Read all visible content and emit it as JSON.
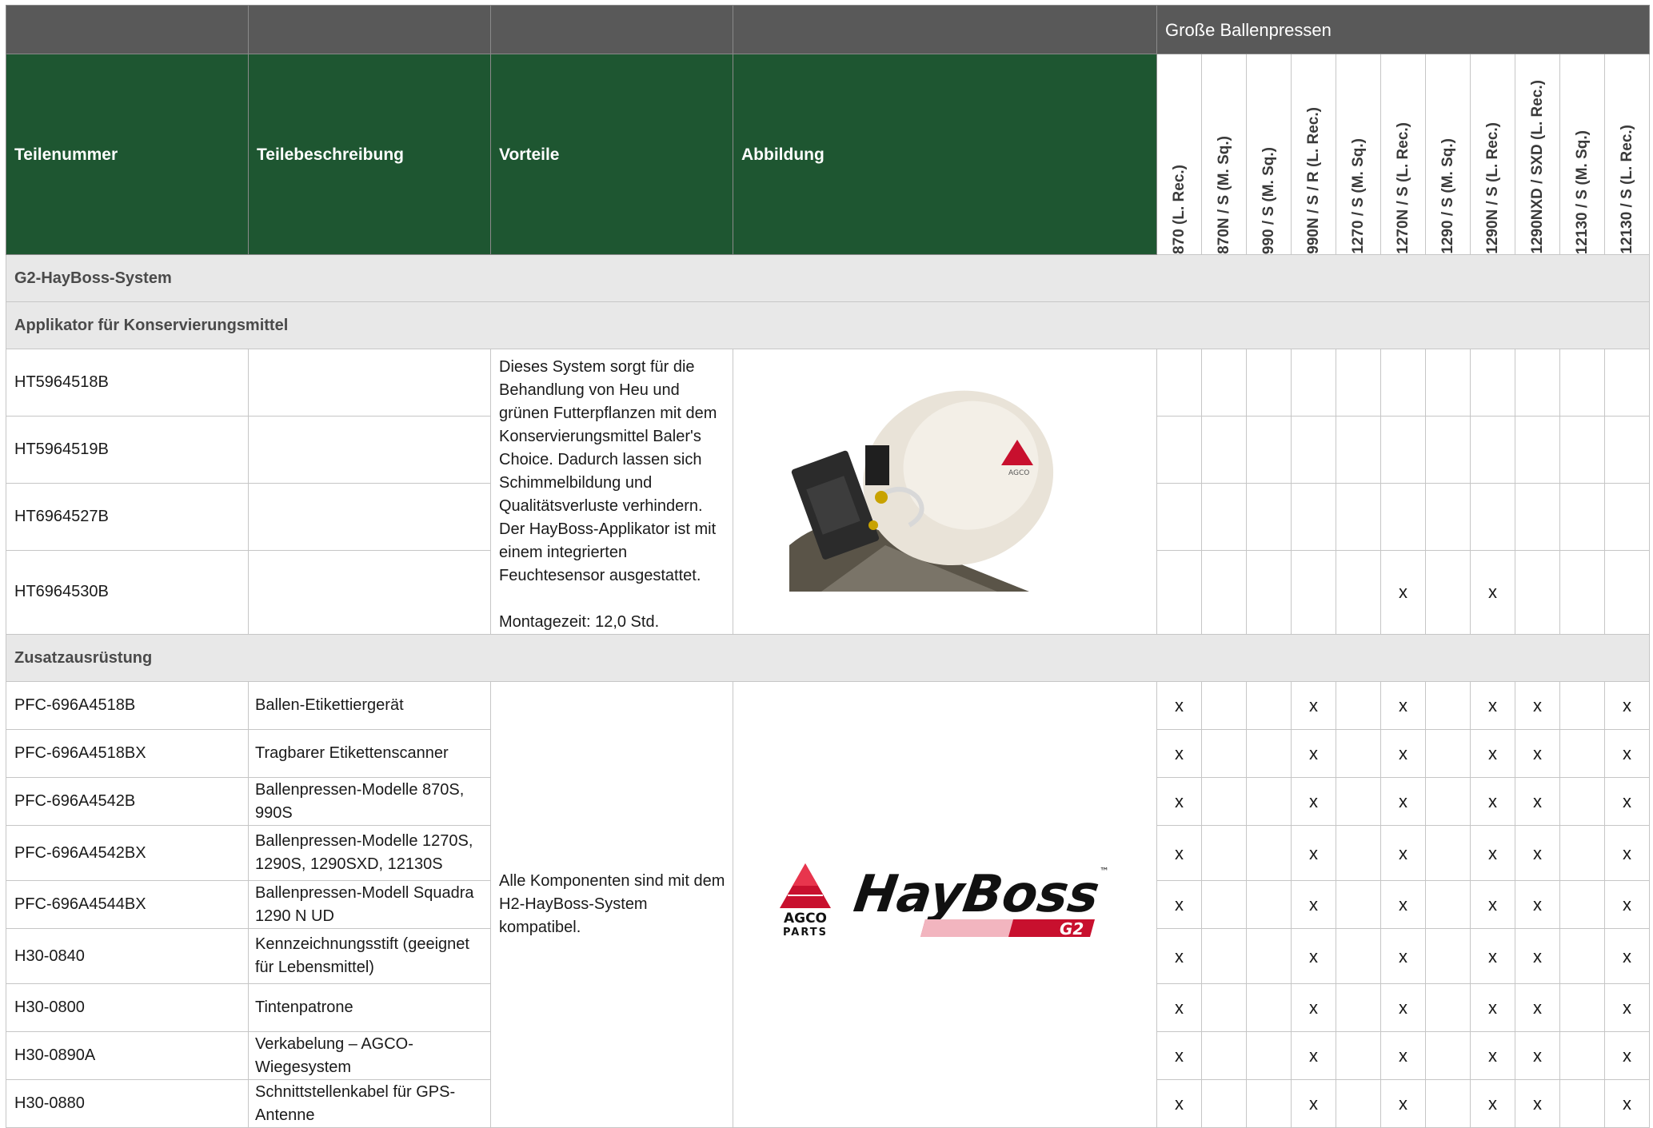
{
  "header": {
    "group_title": "Große Ballenpressen",
    "col_part_number": "Teilenummer",
    "col_description": "Teilebeschreibung",
    "col_benefits": "Vorteile",
    "col_image": "Abbildung",
    "models": [
      "870 (L. Rec.)",
      "870N / S (M. Sq.)",
      "990 / S (M. Sq.)",
      "990N / S / R (L. Rec.)",
      "1270 / S (M. Sq.)",
      "1270N / S (L. Rec.)",
      "1290 / S (M. Sq.)",
      "1290N / S (L. Rec.)",
      "1290NXD / SXD (L. Rec.)",
      "12130 / S (M. Sq.)",
      "12130 / S (L. Rec.)"
    ]
  },
  "sections": {
    "system": "G2-HayBoss-System",
    "applicator": "Applikator für Konservierungsmittel",
    "accessories": "Zusatzausrüstung"
  },
  "applicator_rows": [
    {
      "part": "HT5964518B",
      "desc": "",
      "marks": [
        "",
        "",
        "",
        "",
        "",
        "",
        "",
        "",
        "",
        "",
        ""
      ]
    },
    {
      "part": "HT5964519B",
      "desc": "",
      "marks": [
        "",
        "",
        "",
        "",
        "",
        "",
        "",
        "",
        "",
        "",
        ""
      ]
    },
    {
      "part": "HT6964527B",
      "desc": "",
      "marks": [
        "",
        "",
        "",
        "",
        "",
        "",
        "",
        "",
        "",
        "",
        ""
      ]
    },
    {
      "part": "HT6964530B",
      "desc": "",
      "marks": [
        "",
        "",
        "",
        "",
        "",
        "x",
        "",
        "x",
        "",
        "",
        ""
      ]
    }
  ],
  "applicator_benefits": {
    "text": "Dieses System sorgt für die Behandlung von Heu und grünen Futterpflanzen mit dem Konservierungsmittel Baler's Choice. Dadurch lassen sich Schimmelbildung und Qualitätsverluste verhindern. Der HayBoss-Applikator ist mit einem integrierten Feuchtesensor ausgestattet.",
    "mounting": "Montagezeit: 12,0 Std."
  },
  "applicator_image": {
    "label": "AGCO",
    "icon": "hayboss-applicator-photo"
  },
  "accessory_rows": [
    {
      "part": "PFC-696A4518B",
      "desc": "Ballen-Etikettiergerät",
      "marks": [
        "x",
        "",
        "",
        "x",
        "",
        "x",
        "",
        "x",
        "x",
        "",
        "x"
      ]
    },
    {
      "part": "PFC-696A4518BX",
      "desc": "Tragbarer Etikettenscanner",
      "marks": [
        "x",
        "",
        "",
        "x",
        "",
        "x",
        "",
        "x",
        "x",
        "",
        "x"
      ]
    },
    {
      "part": "PFC-696A4542B",
      "desc": "Ballenpressen-Modelle 870S, 990S",
      "marks": [
        "x",
        "",
        "",
        "x",
        "",
        "x",
        "",
        "x",
        "x",
        "",
        "x"
      ]
    },
    {
      "part": "PFC-696A4542BX",
      "desc": "Ballenpressen-Modelle 1270S, 1290S, 1290SXD, 12130S",
      "marks": [
        "x",
        "",
        "",
        "x",
        "",
        "x",
        "",
        "x",
        "x",
        "",
        "x"
      ]
    },
    {
      "part": "PFC-696A4544BX",
      "desc": "Ballenpressen-Modell Squadra 1290 N UD",
      "marks": [
        "x",
        "",
        "",
        "x",
        "",
        "x",
        "",
        "x",
        "x",
        "",
        "x"
      ]
    },
    {
      "part": "H30-0840",
      "desc": "Kennzeichnungsstift (geeignet für Lebensmittel)",
      "marks": [
        "x",
        "",
        "",
        "x",
        "",
        "x",
        "",
        "x",
        "x",
        "",
        "x"
      ]
    },
    {
      "part": "H30-0800",
      "desc": "Tintenpatrone",
      "marks": [
        "x",
        "",
        "",
        "x",
        "",
        "x",
        "",
        "x",
        "x",
        "",
        "x"
      ]
    },
    {
      "part": "H30-0890A",
      "desc": "Verkabelung – AGCO-Wiegesystem",
      "marks": [
        "x",
        "",
        "",
        "x",
        "",
        "x",
        "",
        "x",
        "x",
        "",
        "x"
      ]
    },
    {
      "part": "H30-0880",
      "desc": "Schnittstellenkabel für GPS-Antenne",
      "marks": [
        "x",
        "",
        "",
        "x",
        "",
        "x",
        "",
        "x",
        "x",
        "",
        "x"
      ]
    }
  ],
  "accessory_benefits": "Alle Komponenten sind mit dem H2-HayBoss-System kompatibel.",
  "logo": {
    "agco_top": "AGCO",
    "agco_bottom": "PARTS",
    "brand": "HayBoss",
    "tm": "™",
    "badge": "G2",
    "colors": {
      "red": "#c8102e",
      "black": "#111111"
    }
  },
  "colors": {
    "header_gray": "#595959",
    "header_green": "#1e5631",
    "section_gray": "#e8e8e8"
  }
}
